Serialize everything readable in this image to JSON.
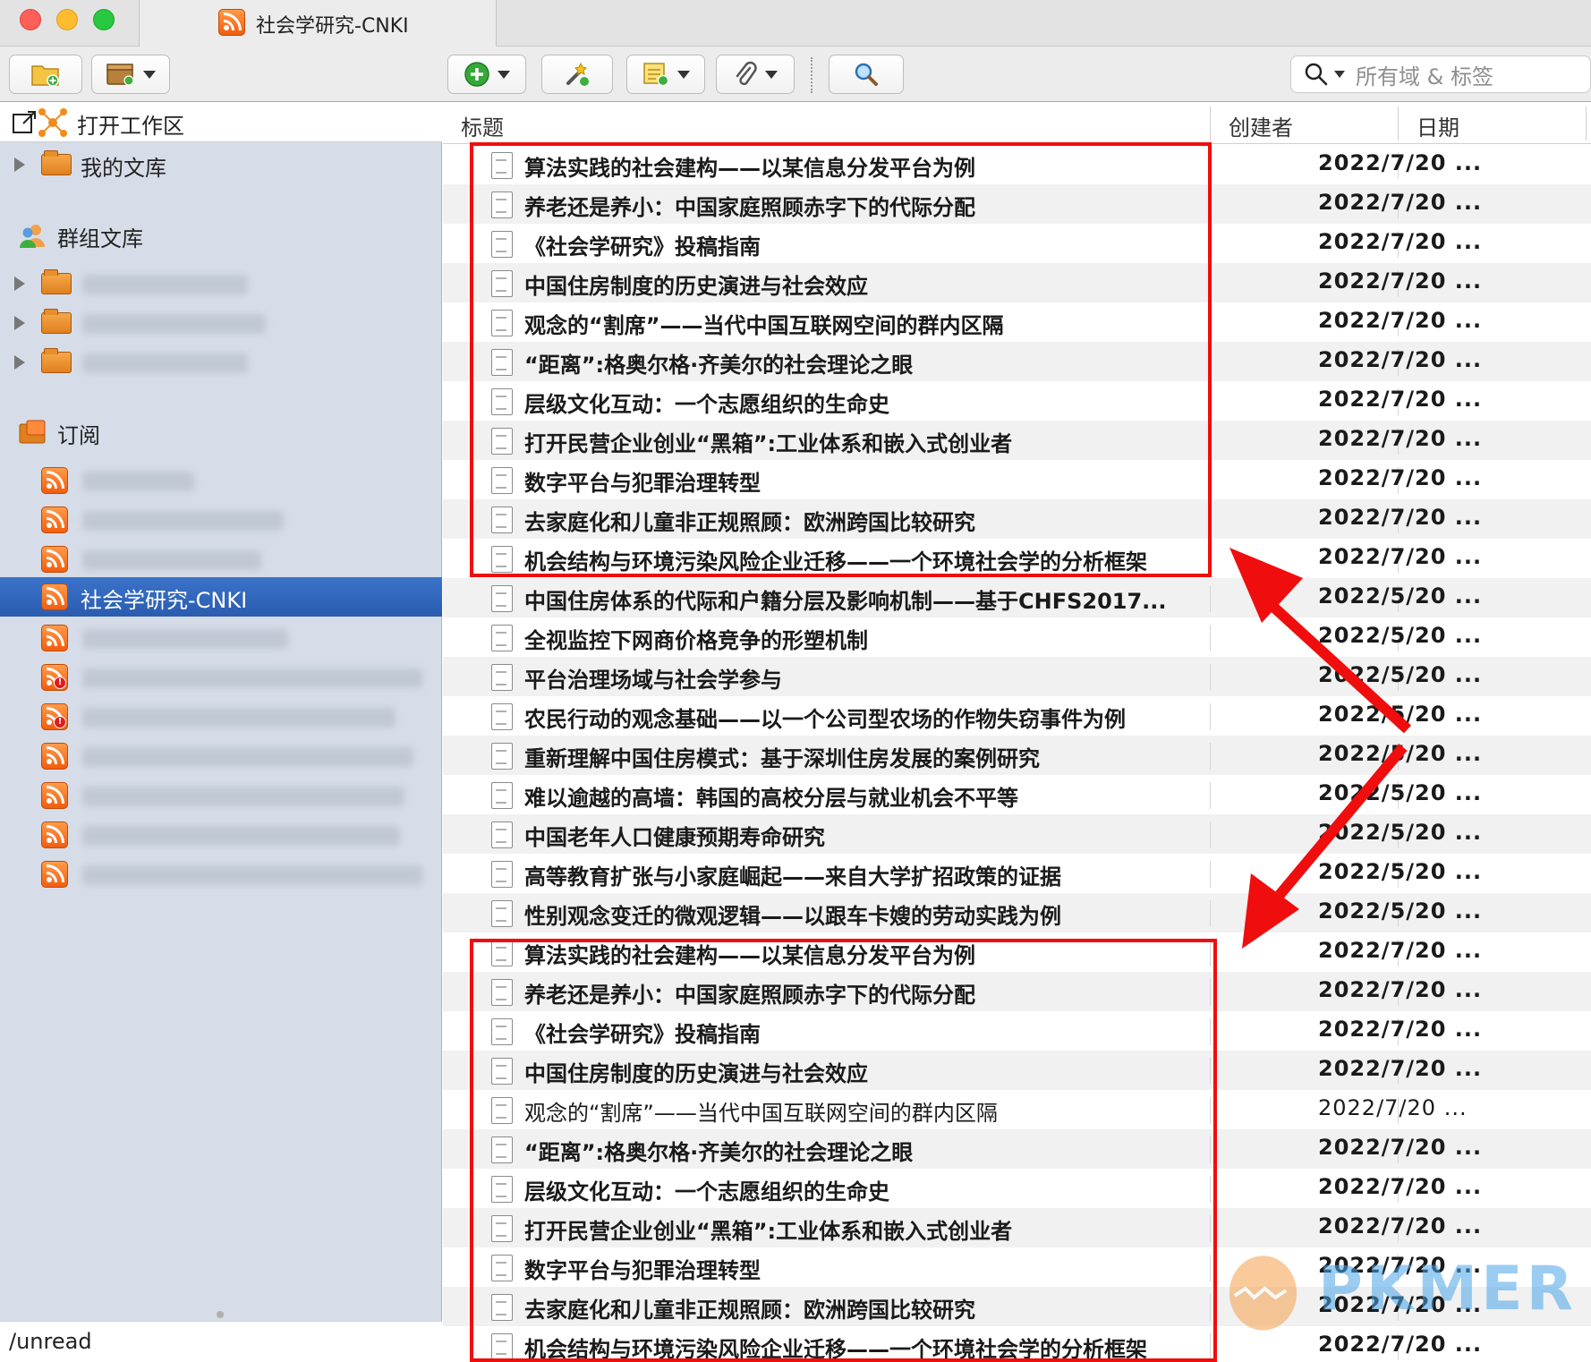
{
  "window": {
    "tab_title": "社会学研究-CNKI"
  },
  "toolbar": {
    "search_placeholder": "所有域 & 标签"
  },
  "sidebar": {
    "workspace": "打开工作区",
    "my_library": "我的文库",
    "group_library": "群组文库",
    "feeds_header": "订阅",
    "selected_feed": "社会学研究-CNKI"
  },
  "columns": {
    "title": "标题",
    "creator": "创建者",
    "date": "日期"
  },
  "items": [
    {
      "title": "算法实践的社会建构——以某信息分发平台为例",
      "date": "2022/7/20 ...",
      "bold": true
    },
    {
      "title": "养老还是养小：中国家庭照顾赤字下的代际分配",
      "date": "2022/7/20 ...",
      "bold": true
    },
    {
      "title": "《社会学研究》投稿指南",
      "date": "2022/7/20 ...",
      "bold": true
    },
    {
      "title": "中国住房制度的历史演进与社会效应",
      "date": "2022/7/20 ...",
      "bold": true
    },
    {
      "title": "观念的“割席”——当代中国互联网空间的群内区隔",
      "date": "2022/7/20 ...",
      "bold": true
    },
    {
      "title": "“距离”:格奥尔格·齐美尔的社会理论之眼",
      "date": "2022/7/20 ...",
      "bold": true
    },
    {
      "title": "层级文化互动：一个志愿组织的生命史",
      "date": "2022/7/20 ...",
      "bold": true
    },
    {
      "title": "打开民营企业创业“黑箱”:工业体系和嵌入式创业者",
      "date": "2022/7/20 ...",
      "bold": true
    },
    {
      "title": "数字平台与犯罪治理转型",
      "date": "2022/7/20 ...",
      "bold": true
    },
    {
      "title": "去家庭化和儿童非正规照顾：欧洲跨国比较研究",
      "date": "2022/7/20 ...",
      "bold": true
    },
    {
      "title": "机会结构与环境污染风险企业迁移——一个环境社会学的分析框架",
      "date": "2022/7/20 ...",
      "bold": true
    },
    {
      "title": "中国住房体系的代际和户籍分层及影响机制——基于CHFS2017...",
      "date": "2022/5/20 ...",
      "bold": true
    },
    {
      "title": "全视监控下网商价格竞争的形塑机制",
      "date": "2022/5/20 ...",
      "bold": true
    },
    {
      "title": "平台治理场域与社会学参与",
      "date": "2022/5/20 ...",
      "bold": true
    },
    {
      "title": "农民行动的观念基础——以一个公司型农场的作物失窃事件为例",
      "date": "2022/5/20 ...",
      "bold": true
    },
    {
      "title": "重新理解中国住房模式：基于深圳住房发展的案例研究",
      "date": "2022/5/20 ...",
      "bold": true
    },
    {
      "title": "难以逾越的高墙：韩国的高校分层与就业机会不平等",
      "date": "2022/5/20 ...",
      "bold": true
    },
    {
      "title": "中国老年人口健康预期寿命研究",
      "date": "2022/5/20 ...",
      "bold": true
    },
    {
      "title": "高等教育扩张与小家庭崛起——来自大学扩招政策的证据",
      "date": "2022/5/20 ...",
      "bold": true
    },
    {
      "title": "性别观念变迁的微观逻辑——以跟车卡嫂的劳动实践为例",
      "date": "2022/5/20 ...",
      "bold": true
    },
    {
      "title": "算法实践的社会建构——以某信息分发平台为例",
      "date": "2022/7/20 ...",
      "bold": true
    },
    {
      "title": "养老还是养小：中国家庭照顾赤字下的代际分配",
      "date": "2022/7/20 ...",
      "bold": true
    },
    {
      "title": "《社会学研究》投稿指南",
      "date": "2022/7/20 ...",
      "bold": true
    },
    {
      "title": "中国住房制度的历史演进与社会效应",
      "date": "2022/7/20 ...",
      "bold": true
    },
    {
      "title": "观念的“割席”——当代中国互联网空间的群内区隔",
      "date": "2022/7/20 ...",
      "bold": false
    },
    {
      "title": "“距离”:格奥尔格·齐美尔的社会理论之眼",
      "date": "2022/7/20 ...",
      "bold": true
    },
    {
      "title": "层级文化互动：一个志愿组织的生命史",
      "date": "2022/7/20 ...",
      "bold": true
    },
    {
      "title": "打开民营企业创业“黑箱”:工业体系和嵌入式创业者",
      "date": "2022/7/20 ...",
      "bold": true
    },
    {
      "title": "数字平台与犯罪治理转型",
      "date": "2022/7/20 ...",
      "bold": true
    },
    {
      "title": "去家庭化和儿童非正规照顾：欧洲跨国比较研究",
      "date": "2022/7/20 ...",
      "bold": true
    },
    {
      "title": "机会结构与环境污染风险企业迁移——一个环境社会学的分析框架",
      "date": "2022/7/20 ...",
      "bold": true
    }
  ],
  "statusbar": {
    "text": "/unread"
  },
  "watermark": {
    "text": "PKMER"
  },
  "colors": {
    "selection": "#2f64b9",
    "sidebar_bg": "#d6dde8",
    "annotation": "#f00d0d",
    "rss": "#f25d0e"
  }
}
